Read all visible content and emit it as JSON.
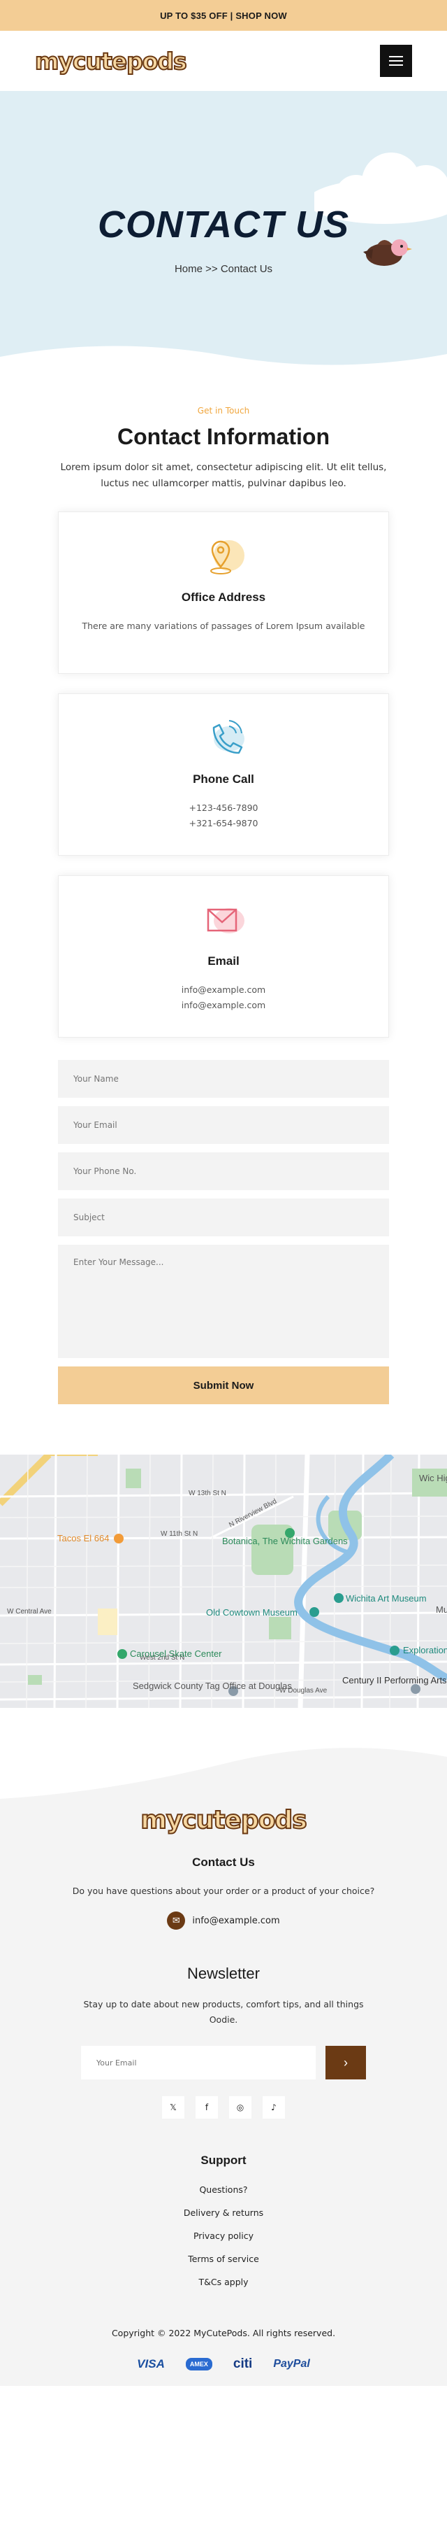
{
  "topbar": {
    "text": "UP TO $35 OFF | SHOP NOW"
  },
  "brand": {
    "logo_text": "mycutepods"
  },
  "hero": {
    "title": "CONTACT US",
    "breadcrumb": "Home >> Contact Us"
  },
  "contact": {
    "eyebrow": "Get in Touch",
    "title": "Contact Information",
    "description": "Lorem ipsum dolor sit amet, consectetur adipiscing elit. Ut elit tellus, luctus nec ullamcorper mattis, pulvinar dapibus leo.",
    "cards": [
      {
        "icon": "location-pin-icon",
        "title": "Office Address",
        "lines": [
          "There are many variations of passages of Lorem Ipsum available"
        ]
      },
      {
        "icon": "phone-icon",
        "title": "Phone Call",
        "lines": [
          "+123-456-7890",
          "+321-654-9870"
        ]
      },
      {
        "icon": "envelope-icon",
        "title": "Email",
        "lines": [
          "info@example.com",
          "info@example.com"
        ]
      }
    ]
  },
  "form": {
    "name_placeholder": "Your Name",
    "email_placeholder": "Your Email",
    "phone_placeholder": "Your Phone No.",
    "subject_placeholder": "Subject",
    "message_placeholder": "Enter Your Message...",
    "submit_label": "Submit Now"
  },
  "map": {
    "labels": {
      "street_13th": "W 13th St N",
      "street_11th": "W 11th St N",
      "river_blvd": "N Riverview Blvd",
      "taco": "Tacos El 664",
      "botanica": "Botanica, The Wichita Gardens",
      "art_museum": "Wichita Art Museum",
      "old_cowtown": "Old Cowtown Museum",
      "central": "W Central Ave",
      "skate": "Carousel Skate Center",
      "second_st": "West 2nd St N",
      "sedgwick": "Sedgwick County Tag Office at Douglas",
      "douglas": "W Douglas Ave",
      "century": "Century II Performing Arts Center",
      "exploration": "Exploration",
      "mu": "Mu",
      "wichita_corner": "Wic Hig"
    }
  },
  "footer": {
    "contact_title": "Contact Us",
    "contact_text": "Do you have questions about your order or a product of your choice?",
    "email": "info@example.com",
    "newsletter_title": "Newsletter",
    "newsletter_text": "Stay up to date about new products, comfort tips, and all things Oodie.",
    "newsletter_placeholder": "Your Email",
    "support_title": "Support",
    "support_links": [
      "Questions?",
      "Delivery & returns",
      "Privacy policy",
      "Terms of service",
      "T&Cs apply"
    ],
    "copyright": "Copyright © 2022 MyCutePods. All rights reserved.",
    "payments": {
      "visa": "VISA",
      "amex": "AMEX",
      "citi": "citi",
      "paypal": "PayPal"
    },
    "social": {
      "twitter": "𝕏",
      "facebook": "f",
      "instagram": "◎",
      "tiktok": "♪"
    }
  },
  "colors": {
    "accent": "#f3cd95",
    "brown": "#6b3a14",
    "hero_bg": "#dfeef4",
    "eyebrow": "#f0a63d"
  }
}
